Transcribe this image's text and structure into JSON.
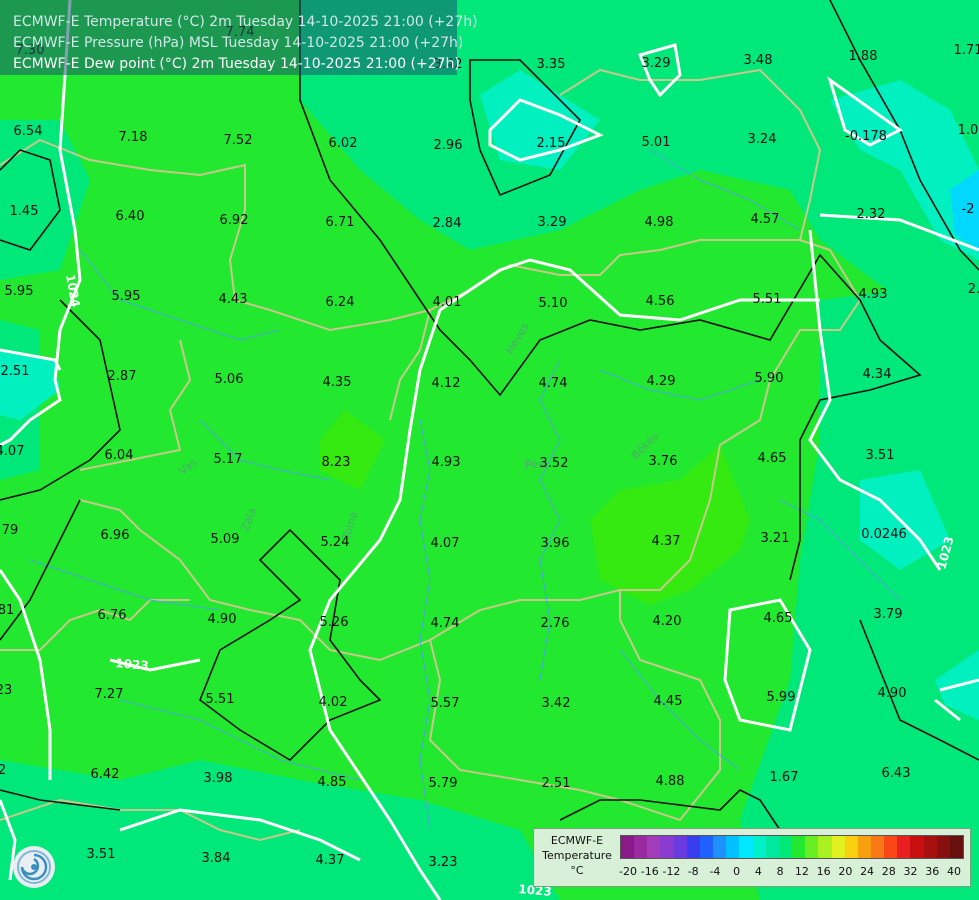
{
  "header": {
    "line1": "ECMWF-E Temperature (°C) 2m Tuesday 14-10-2025 21:00 (+27h)",
    "line2": "ECMWF-E Pressure (hPa) MSL Tuesday 14-10-2025 21:00 (+27h)",
    "line3": "ECMWF-E Dew point (°C) 2m Tuesday 14-10-2025 21:00 (+27h)"
  },
  "legend": {
    "title_lines": [
      "ECMWF-E",
      "Temperature",
      "°C"
    ],
    "ticks": [
      "-20",
      "-16",
      "-12",
      "-8",
      "-4",
      "0",
      "4",
      "8",
      "12",
      "16",
      "20",
      "24",
      "28",
      "32",
      "36",
      "40"
    ],
    "colors": [
      "#8a1a8a",
      "#9a2aa0",
      "#a23cb8",
      "#8a3cd0",
      "#6a3ce0",
      "#3a3cf0",
      "#2060ff",
      "#1e90ff",
      "#00c0ff",
      "#00e8ff",
      "#00f0c8",
      "#00e8a0",
      "#00e878",
      "#22e830",
      "#66ee22",
      "#a8f020",
      "#e0f020",
      "#f8d010",
      "#f8a010",
      "#f87818",
      "#f84818",
      "#e82020",
      "#c81010",
      "#a81010",
      "#881010",
      "#681010"
    ]
  },
  "isobar_labels": [
    "1024",
    "1023",
    "1023",
    "1023"
  ],
  "dew_points": [
    {
      "v": "7.30"
    },
    {
      "v": "7.74"
    },
    {
      "v": "3.42"
    },
    {
      "v": "3.35"
    },
    {
      "v": "3.29"
    },
    {
      "v": "3.48"
    },
    {
      "v": "1.88"
    },
    {
      "v": "1.71"
    },
    {
      "v": "6.54"
    },
    {
      "v": "7.18"
    },
    {
      "v": "7.52"
    },
    {
      "v": "6.02"
    },
    {
      "v": "2.96"
    },
    {
      "v": "2.15"
    },
    {
      "v": "5.01"
    },
    {
      "v": "3.24"
    },
    {
      "v": "-0.178"
    },
    {
      "v": "1.0"
    },
    {
      "v": "1.45"
    },
    {
      "v": "6.40"
    },
    {
      "v": "6.92"
    },
    {
      "v": "6.71"
    },
    {
      "v": "2.84"
    },
    {
      "v": "3.29"
    },
    {
      "v": "4.98"
    },
    {
      "v": "4.57"
    },
    {
      "v": "2.32"
    },
    {
      "v": "-2"
    },
    {
      "v": "5.95"
    },
    {
      "v": "5.95"
    },
    {
      "v": "4.43"
    },
    {
      "v": "6.24"
    },
    {
      "v": "4.01"
    },
    {
      "v": "5.10"
    },
    {
      "v": "4.56"
    },
    {
      "v": "5.51"
    },
    {
      "v": "4.93"
    },
    {
      "v": "2."
    },
    {
      "v": "2.51"
    },
    {
      "v": "2.87"
    },
    {
      "v": "5.06"
    },
    {
      "v": "4.35"
    },
    {
      "v": "4.12"
    },
    {
      "v": "4.74"
    },
    {
      "v": "4.29"
    },
    {
      "v": "5.90"
    },
    {
      "v": "4.34"
    },
    {
      "v": "4.07"
    },
    {
      "v": "6.04"
    },
    {
      "v": "5.17"
    },
    {
      "v": "8.23"
    },
    {
      "v": "4.93"
    },
    {
      "v": "3.52"
    },
    {
      "v": "3.76"
    },
    {
      "v": "4.65"
    },
    {
      "v": "3.51"
    },
    {
      "v": "79"
    },
    {
      "v": "6.96"
    },
    {
      "v": "5.09"
    },
    {
      "v": "5.24"
    },
    {
      "v": "4.07"
    },
    {
      "v": "3.96"
    },
    {
      "v": "4.37"
    },
    {
      "v": "3.21"
    },
    {
      "v": "0.0246"
    },
    {
      "v": "81"
    },
    {
      "v": "6.76"
    },
    {
      "v": "4.90"
    },
    {
      "v": "5.26"
    },
    {
      "v": "4.74"
    },
    {
      "v": "2.76"
    },
    {
      "v": "4.20"
    },
    {
      "v": "4.65"
    },
    {
      "v": "3.79"
    },
    {
      "v": "23"
    },
    {
      "v": "7.27"
    },
    {
      "v": "5.51"
    },
    {
      "v": "4.02"
    },
    {
      "v": "5.57"
    },
    {
      "v": "3.42"
    },
    {
      "v": "4.45"
    },
    {
      "v": "5.99"
    },
    {
      "v": "4.90"
    },
    {
      "v": "2"
    },
    {
      "v": "6.42"
    },
    {
      "v": "3.98"
    },
    {
      "v": "4.85"
    },
    {
      "v": "5.79"
    },
    {
      "v": "2.51"
    },
    {
      "v": "4.88"
    },
    {
      "v": "1.67"
    },
    {
      "v": "6.43"
    },
    {
      "v": "3.51"
    },
    {
      "v": "3.84"
    },
    {
      "v": "4.37"
    },
    {
      "v": "3.23"
    }
  ],
  "place_labels": [
    "Heves",
    "Pest",
    "Békés",
    "Vas",
    "Zala",
    "Tolna"
  ]
}
